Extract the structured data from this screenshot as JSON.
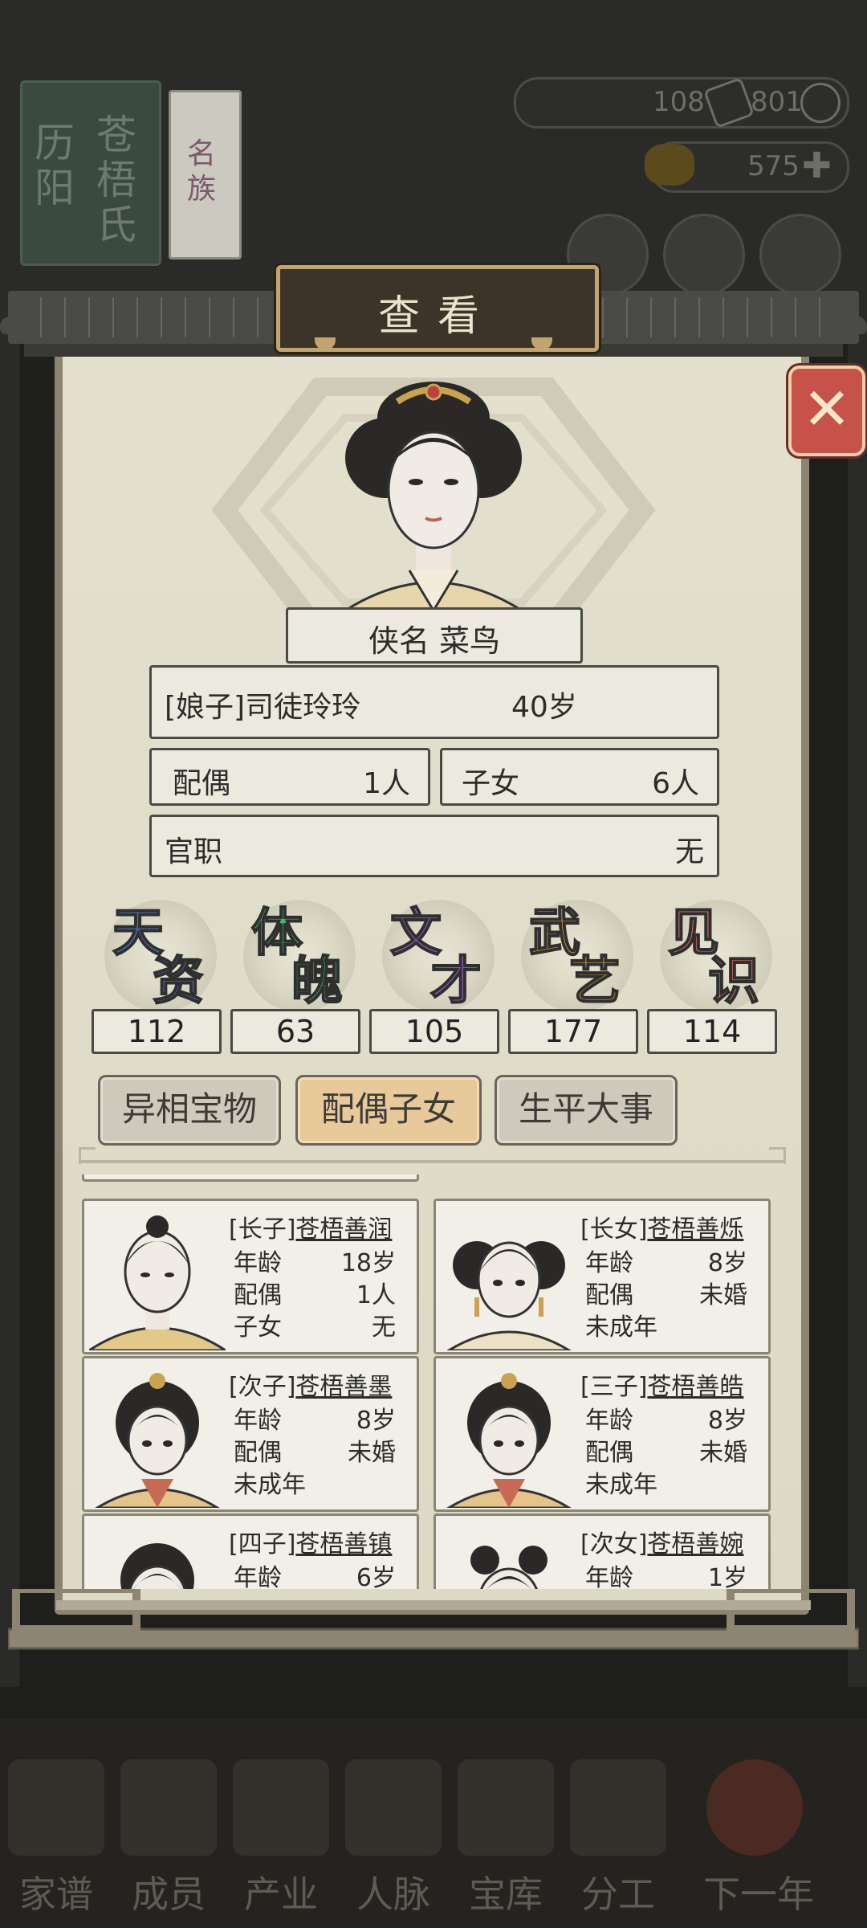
{
  "background": {
    "clan_book": {
      "vol1_text": "历阳",
      "vol2_text": "苍梧氏",
      "vol3_text": "名族"
    },
    "resources": [
      {
        "value": "108"
      },
      {
        "value": "801"
      },
      {
        "value": "575"
      }
    ],
    "bottom_nav": [
      {
        "label": "家谱"
      },
      {
        "label": "成员"
      },
      {
        "label": "产业"
      },
      {
        "label": "人脉"
      },
      {
        "label": "宝库"
      },
      {
        "label": "分工"
      },
      {
        "label": "下一年"
      }
    ]
  },
  "dialog": {
    "title": "查看",
    "nickname_label": "侠名",
    "nickname": "菜鸟",
    "identity": "[娘子]司徒玲玲",
    "age": "40岁",
    "spouse_label": "配偶",
    "spouse_count": "1人",
    "children_label": "子女",
    "children_count": "6人",
    "office_label": "官职",
    "office_value": "无",
    "stats": [
      {
        "top": "天",
        "bottom": "资",
        "value": "112",
        "color": "#4f7fd6"
      },
      {
        "top": "体",
        "bottom": "魄",
        "value": "63",
        "color": "#41b86f"
      },
      {
        "top": "文",
        "bottom": "才",
        "value": "105",
        "color": "#9a5cd0"
      },
      {
        "top": "武",
        "bottom": "艺",
        "value": "177",
        "color": "#e0a53a"
      },
      {
        "top": "见",
        "bottom": "识",
        "value": "114",
        "color": "#e06b60"
      }
    ],
    "tabs": [
      {
        "label": "异相宝物",
        "active": false
      },
      {
        "label": "配偶子女",
        "active": true
      },
      {
        "label": "生平大事",
        "active": false
      }
    ],
    "children": [
      {
        "role": "[长子]",
        "name": "苍梧善润",
        "age_label": "年龄",
        "age": "18岁",
        "spouse_label": "配偶",
        "spouse": "1人",
        "kids_label": "子女",
        "kids": "无"
      },
      {
        "role": "[长女]",
        "name": "苍梧善烁",
        "age_label": "年龄",
        "age": "8岁",
        "spouse_label": "配偶",
        "spouse": "未婚",
        "status": "未成年"
      },
      {
        "role": "[次子]",
        "name": "苍梧善墨",
        "age_label": "年龄",
        "age": "8岁",
        "spouse_label": "配偶",
        "spouse": "未婚",
        "status": "未成年"
      },
      {
        "role": "[三子]",
        "name": "苍梧善皓",
        "age_label": "年龄",
        "age": "8岁",
        "spouse_label": "配偶",
        "spouse": "未婚",
        "status": "未成年"
      },
      {
        "role": "[四子]",
        "name": "苍梧善镇",
        "age_label": "年龄",
        "age": "6岁"
      },
      {
        "role": "[次女]",
        "name": "苍梧善婉",
        "age_label": "年龄",
        "age": "1岁"
      }
    ]
  }
}
